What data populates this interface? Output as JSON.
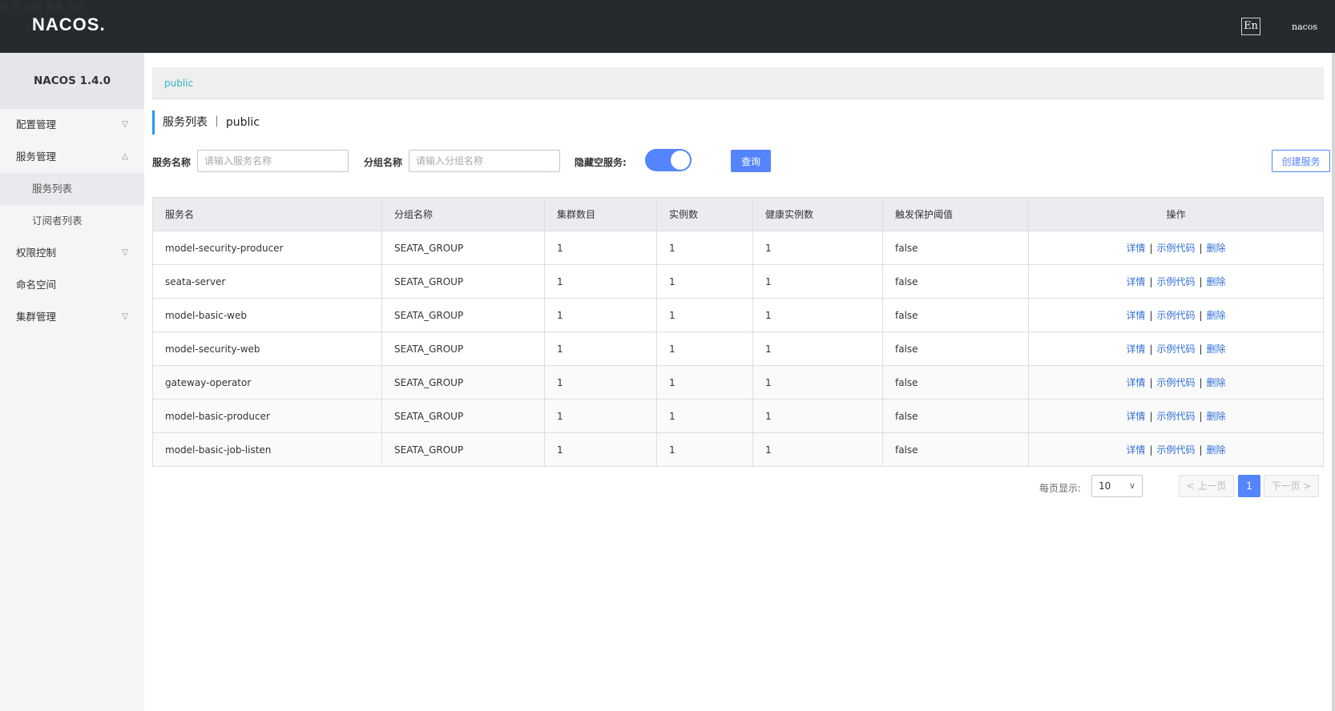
{
  "header": {
    "logo": "NACOS.",
    "nav": [
      "首页",
      "文档",
      "博客",
      "社区"
    ],
    "lang": "En",
    "user": "nacos"
  },
  "sidebar": {
    "title": "NACOS 1.4.0",
    "items": [
      {
        "label": "配置管理",
        "chevron": "▽"
      },
      {
        "label": "服务管理",
        "chevron": "△"
      },
      {
        "label": "服务列表"
      },
      {
        "label": "订阅者列表"
      },
      {
        "label": "权限控制",
        "chevron": "▽"
      },
      {
        "label": "命名空间"
      },
      {
        "label": "集群管理",
        "chevron": "▽"
      }
    ]
  },
  "breadcrumb": "public",
  "page_title": "服务列表 ｜ public",
  "search": {
    "service_label": "服务名称",
    "service_placeholder": "请输入服务名称",
    "group_label": "分组名称",
    "group_placeholder": "请输入分组名称",
    "hide_empty_label": "隐藏空服务:",
    "hide_empty_on": true,
    "query_label": "查询",
    "create_label": "创建服务"
  },
  "table": {
    "headers": [
      "服务名",
      "分组名称",
      "集群数目",
      "实例数",
      "健康实例数",
      "触发保护阈值",
      "操作"
    ],
    "rows": [
      [
        "model-security-producer",
        "SEATA_GROUP",
        "1",
        "1",
        "1",
        "false"
      ],
      [
        "seata-server",
        "SEATA_GROUP",
        "1",
        "1",
        "1",
        "false"
      ],
      [
        "model-basic-web",
        "SEATA_GROUP",
        "1",
        "1",
        "1",
        "false"
      ],
      [
        "model-security-web",
        "SEATA_GROUP",
        "1",
        "1",
        "1",
        "false"
      ],
      [
        "gateway-operator",
        "SEATA_GROUP",
        "1",
        "1",
        "1",
        "false"
      ],
      [
        "model-basic-producer",
        "SEATA_GROUP",
        "1",
        "1",
        "1",
        "false"
      ],
      [
        "model-basic-job-listen",
        "SEATA_GROUP",
        "1",
        "1",
        "1",
        "false"
      ]
    ],
    "ops": {
      "detail": "详情",
      "sample": "示例代码",
      "delete": "删除",
      "sep": "|"
    }
  },
  "pagination": {
    "per_page_label": "每页显示:",
    "page_size": "10",
    "prev": "上一页",
    "next": "下一页",
    "current": "1"
  },
  "colors": {
    "header_bg": "#252a2f",
    "primary": "#5584ff",
    "link": "#2f6fd6",
    "breadcrumb": "#2fb6c8"
  }
}
